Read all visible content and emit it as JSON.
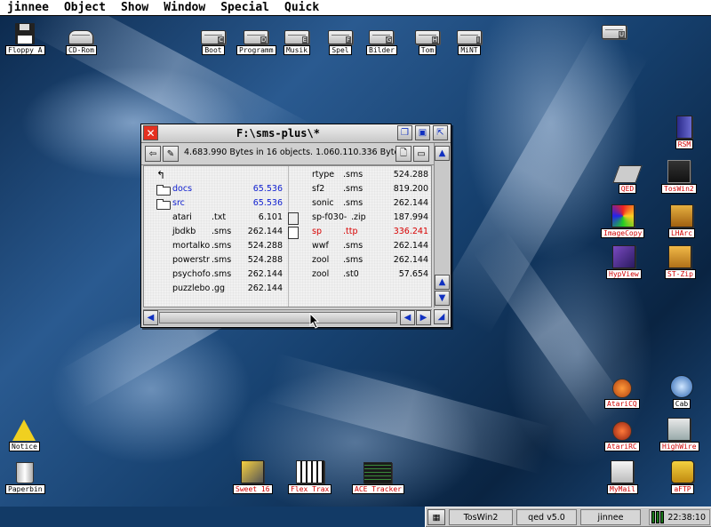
{
  "menubar": {
    "app": "jinnee",
    "items": [
      "Object",
      "Show",
      "Window",
      "Special",
      "Quick"
    ]
  },
  "desktop_icons": {
    "floppy": "Floppy A",
    "cdrom": "CD-Rom",
    "boot": "Boot",
    "programm": "Programm",
    "musik": "Musik",
    "spel": "Spel",
    "bilder": "Bilder",
    "tom": "Tom",
    "mint": "MiNT",
    "net_u": "",
    "rsm": "RSM",
    "qed": "QED",
    "toswin2": "TosWin2",
    "imagecopy": "ImageCopy",
    "lharc": "LHArc",
    "hypview": "HypView",
    "stzip": "ST-Zip",
    "atarlicq": "AtariCQ",
    "cab": "Cab",
    "atarirc": "AtariRC",
    "highwire": "HighWire",
    "mymail": "MyMail",
    "aftp": "aFTP",
    "notice": "Notice",
    "paperbin": "Paperbin",
    "sweet16": "Sweet 16",
    "flextrax": "Flex Trax",
    "acetracker": "ACE Tracker"
  },
  "drive_letters": {
    "floppy": "A",
    "cdrom": "",
    "boot": "C",
    "programm": "D",
    "musik": "E",
    "spel": "F",
    "bilder": "G",
    "tom": "H",
    "mint": "I",
    "net": "U"
  },
  "window": {
    "title": "F:\\sms-plus\\*",
    "info": "4.683.990 Bytes in 16 objects. 1.060.110.336 Bytes free",
    "left_files": [
      {
        "name": "docs",
        "ext": "",
        "size": "65.536",
        "kind": "folder",
        "color": "blue"
      },
      {
        "name": "src",
        "ext": "",
        "size": "65.536",
        "kind": "folder",
        "color": "blue"
      },
      {
        "name": "atari",
        "ext": ".txt",
        "size": "6.101",
        "kind": "file",
        "color": "black"
      },
      {
        "name": "jbdkb",
        "ext": ".sms",
        "size": "262.144",
        "kind": "file",
        "color": "black"
      },
      {
        "name": "mortalko",
        "ext": ".sms",
        "size": "524.288",
        "kind": "file",
        "color": "black"
      },
      {
        "name": "powerstr",
        "ext": ".sms",
        "size": "524.288",
        "kind": "file",
        "color": "black"
      },
      {
        "name": "psychofo",
        "ext": ".sms",
        "size": "262.144",
        "kind": "file",
        "color": "black"
      },
      {
        "name": "puzzlebo",
        "ext": ".gg",
        "size": "262.144",
        "kind": "file",
        "color": "black"
      }
    ],
    "right_files": [
      {
        "name": "rtype",
        "ext": ".sms",
        "size": "524.288",
        "kind": "file",
        "color": "black"
      },
      {
        "name": "sf2",
        "ext": ".sms",
        "size": "819.200",
        "kind": "file",
        "color": "black"
      },
      {
        "name": "sonic",
        "ext": ".sms",
        "size": "262.144",
        "kind": "file",
        "color": "black"
      },
      {
        "name": "sp-f030-",
        "ext": ".zip",
        "size": "187.994",
        "kind": "zip",
        "color": "black"
      },
      {
        "name": "sp",
        "ext": ".ttp",
        "size": "336.241",
        "kind": "app",
        "color": "red"
      },
      {
        "name": "wwf",
        "ext": ".sms",
        "size": "262.144",
        "kind": "file",
        "color": "black"
      },
      {
        "name": "zool",
        "ext": ".sms",
        "size": "262.144",
        "kind": "file",
        "color": "black"
      },
      {
        "name": "zool",
        "ext": ".st0",
        "size": "57.654",
        "kind": "file",
        "color": "black"
      }
    ]
  },
  "taskbar": {
    "tasks": [
      "TosWin2",
      "qed v5.0",
      "jinnee"
    ],
    "clock": "22:38:10"
  },
  "colors": {
    "folder_text": "#1020d0",
    "program_text": "#d80000",
    "close_button": "#e53020"
  }
}
